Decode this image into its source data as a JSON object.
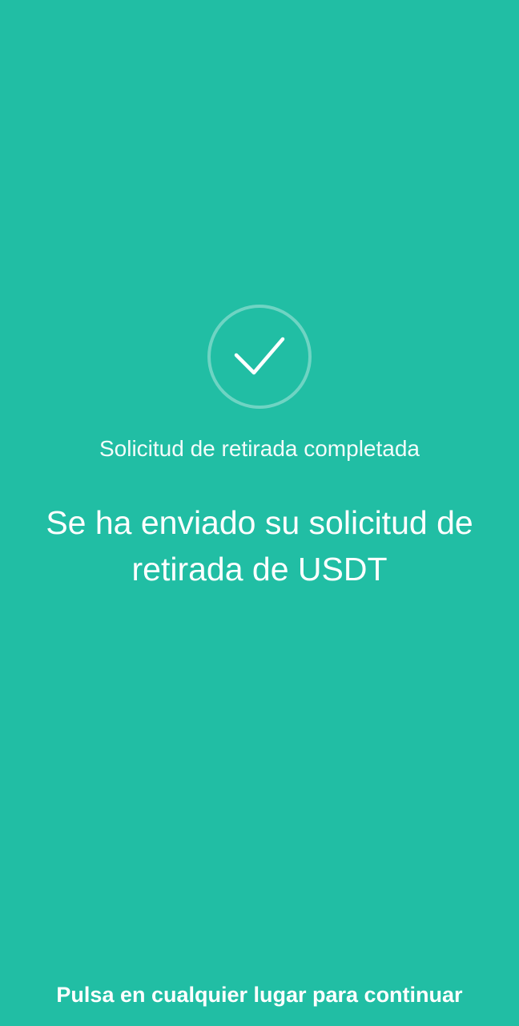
{
  "colors": {
    "background": "#21bea4",
    "text": "#ffffff"
  },
  "status": {
    "icon": "checkmark-icon",
    "subtitle": "Solicitud de retirada completada",
    "message": "Se ha enviado su solicitud de retirada de USDT"
  },
  "footer": {
    "hint": "Pulsa en cualquier lugar para continuar"
  }
}
